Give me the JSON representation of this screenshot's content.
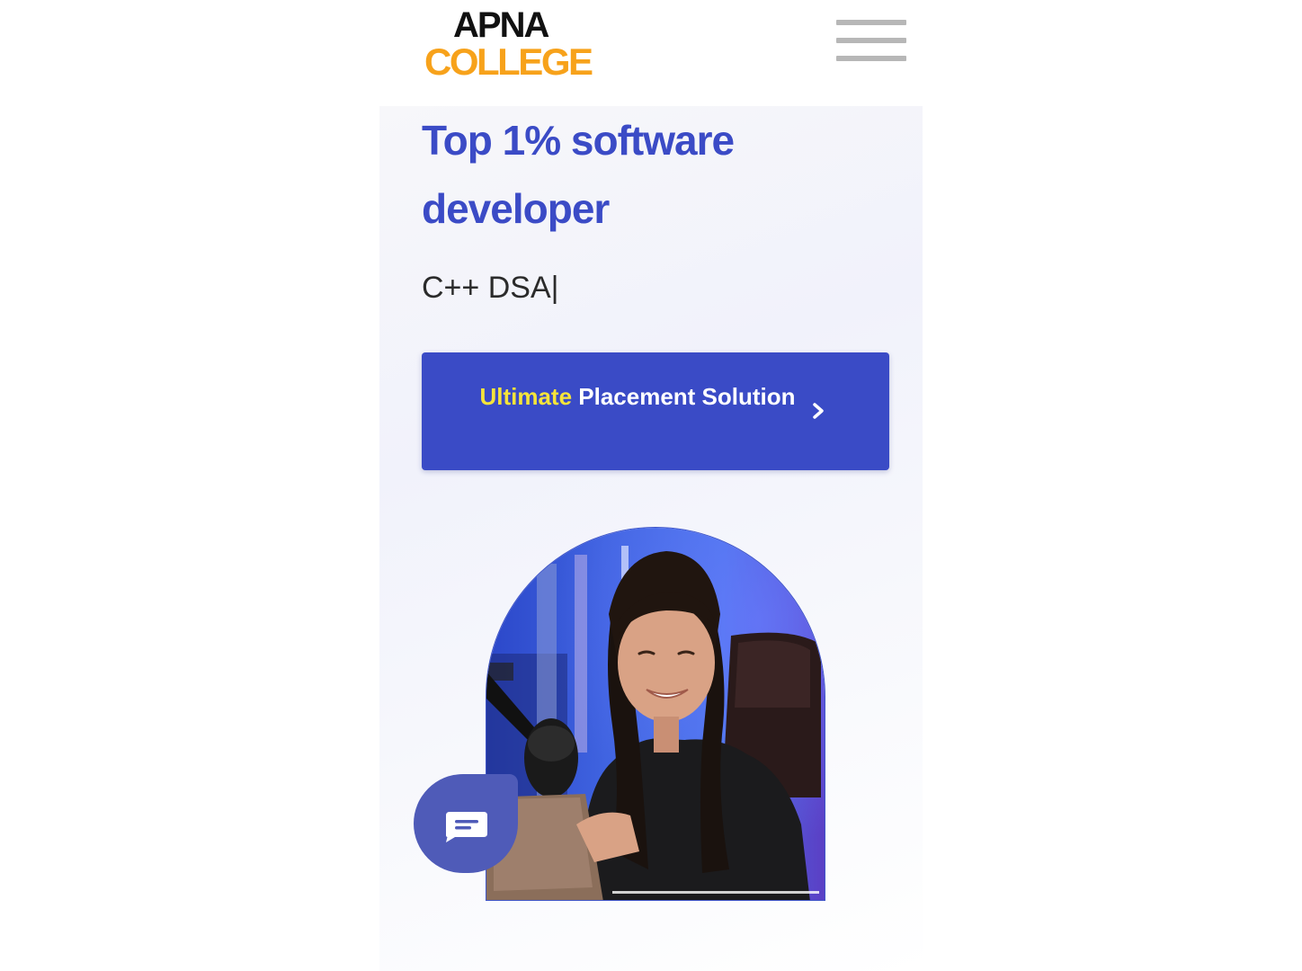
{
  "brand": {
    "logo_line1": "APNA",
    "logo_line2": "COLLEGE",
    "logo_line1_color": "#111111",
    "logo_line2_color": "#f7a21b"
  },
  "header": {
    "menu_icon": "hamburger-menu-icon"
  },
  "hero": {
    "headline": "Top 1% software developer",
    "typed_text": "C++ DSA",
    "typed_cursor": "|",
    "cta": {
      "highlight": "Ultimate",
      "label_rest": " Placement Solution",
      "arrow_icon": "chevron-right-icon",
      "background_color": "#3a4bc6",
      "highlight_color": "#f5e43a"
    },
    "photo_icon": "instructor-photo"
  },
  "chat": {
    "icon": "chat-bubble-icon",
    "color": "#4f5bb8"
  },
  "colors": {
    "headline": "#3b4bc6",
    "accent": "#3a4bc6"
  }
}
